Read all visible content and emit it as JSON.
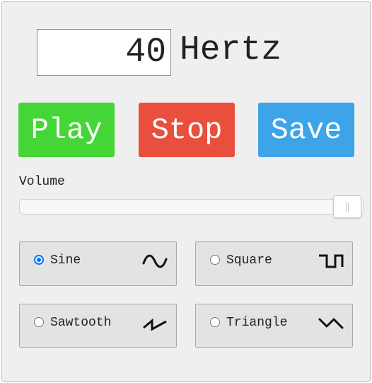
{
  "frequency": {
    "value": "40",
    "unit": "Hertz"
  },
  "buttons": {
    "play": "Play",
    "stop": "Stop",
    "save": "Save"
  },
  "colors": {
    "play": "#44d637",
    "stop": "#ea4e3d",
    "save": "#3da4ea"
  },
  "volume": {
    "label": "Volume",
    "level_fraction": 0.99
  },
  "waveforms": [
    {
      "label": "Sine",
      "checked": true,
      "icon": "sine-wave-icon"
    },
    {
      "label": "Square",
      "checked": false,
      "icon": "square-wave-icon"
    },
    {
      "label": "Sawtooth",
      "checked": false,
      "icon": "sawtooth-wave-icon"
    },
    {
      "label": "Triangle",
      "checked": false,
      "icon": "triangle-wave-icon"
    }
  ]
}
